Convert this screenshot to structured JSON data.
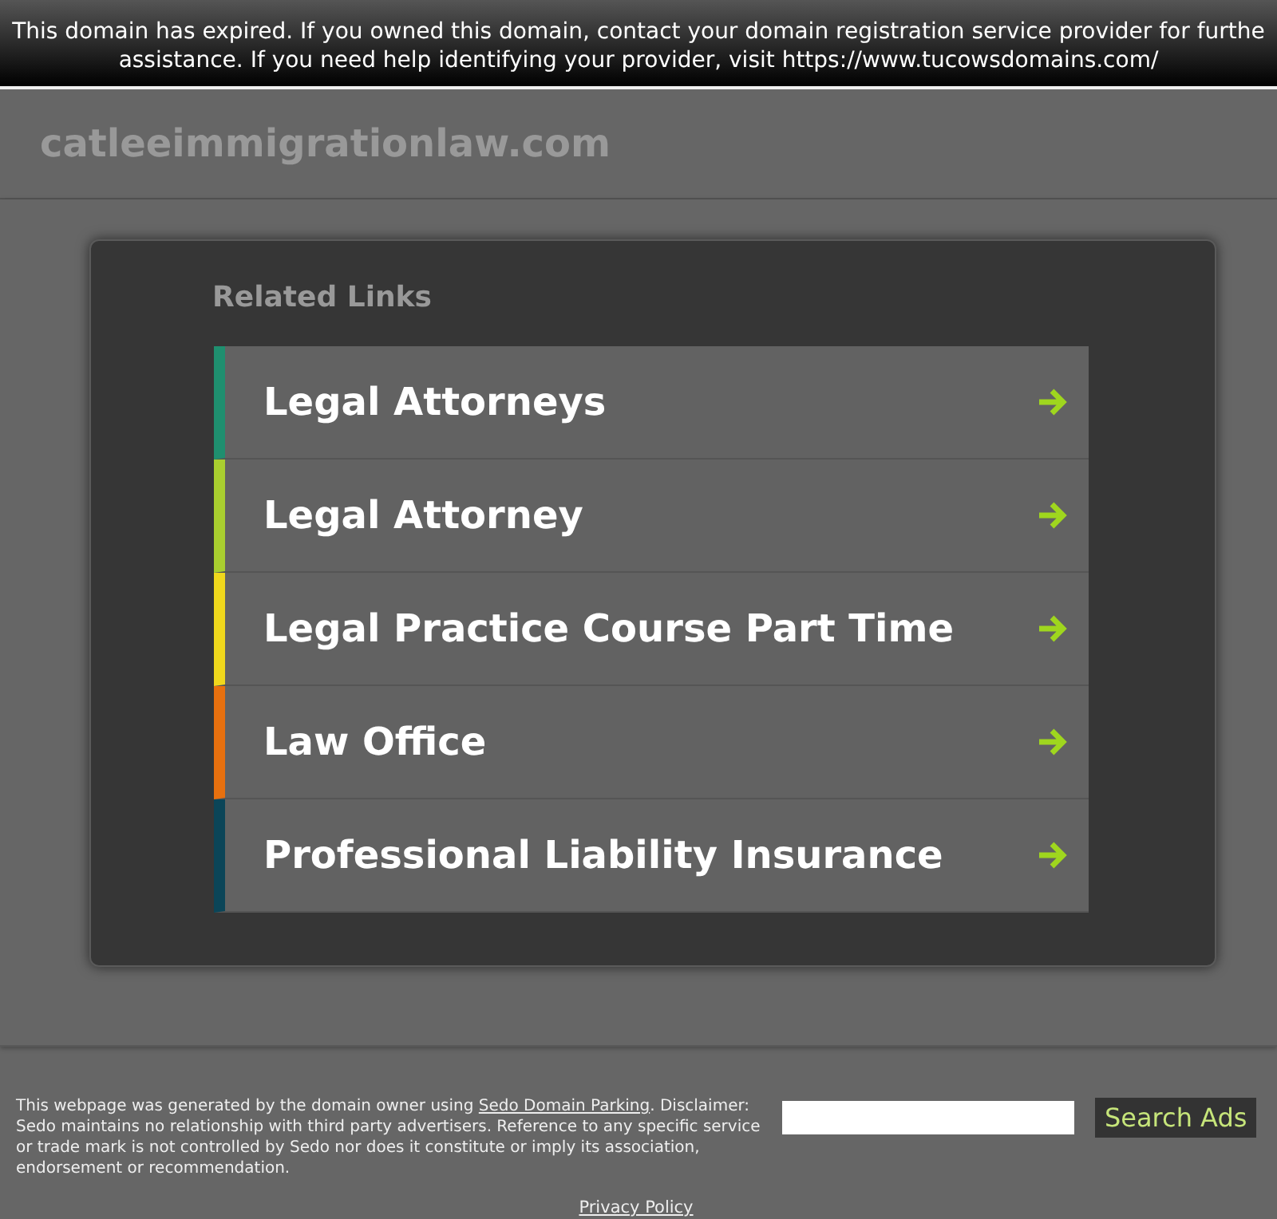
{
  "banner": {
    "lines": [
      "This domain has expired. If you owned this domain, contact your domain registration service provider for furthe",
      "assistance. If you need help identifying your provider, visit https://www.tucowsdomains.com/"
    ]
  },
  "domain": "catleeimmigrationlaw.com",
  "related": {
    "title": "Related Links",
    "links": [
      {
        "label": "Legal Attorneys",
        "color": "#1f8f6f"
      },
      {
        "label": "Legal Attorney",
        "color": "#a9cf2f"
      },
      {
        "label": "Legal Practice Course Part Time",
        "color": "#f0d81c"
      },
      {
        "label": "Law Office",
        "color": "#e8700e"
      },
      {
        "label": "Professional Liability Insurance",
        "color": "#0b4558"
      }
    ]
  },
  "footer": {
    "text_before": "This webpage was generated by the domain owner using ",
    "link": "Sedo Domain Parking",
    "text_after": ". Disclaimer: Sedo maintains no relationship with third party advertisers. Reference to any specific service or trade mark is not controlled by Sedo nor does it constitute or imply its association, endorsement or recommendation.",
    "search_button": "Search Ads",
    "privacy": "Privacy Policy"
  }
}
